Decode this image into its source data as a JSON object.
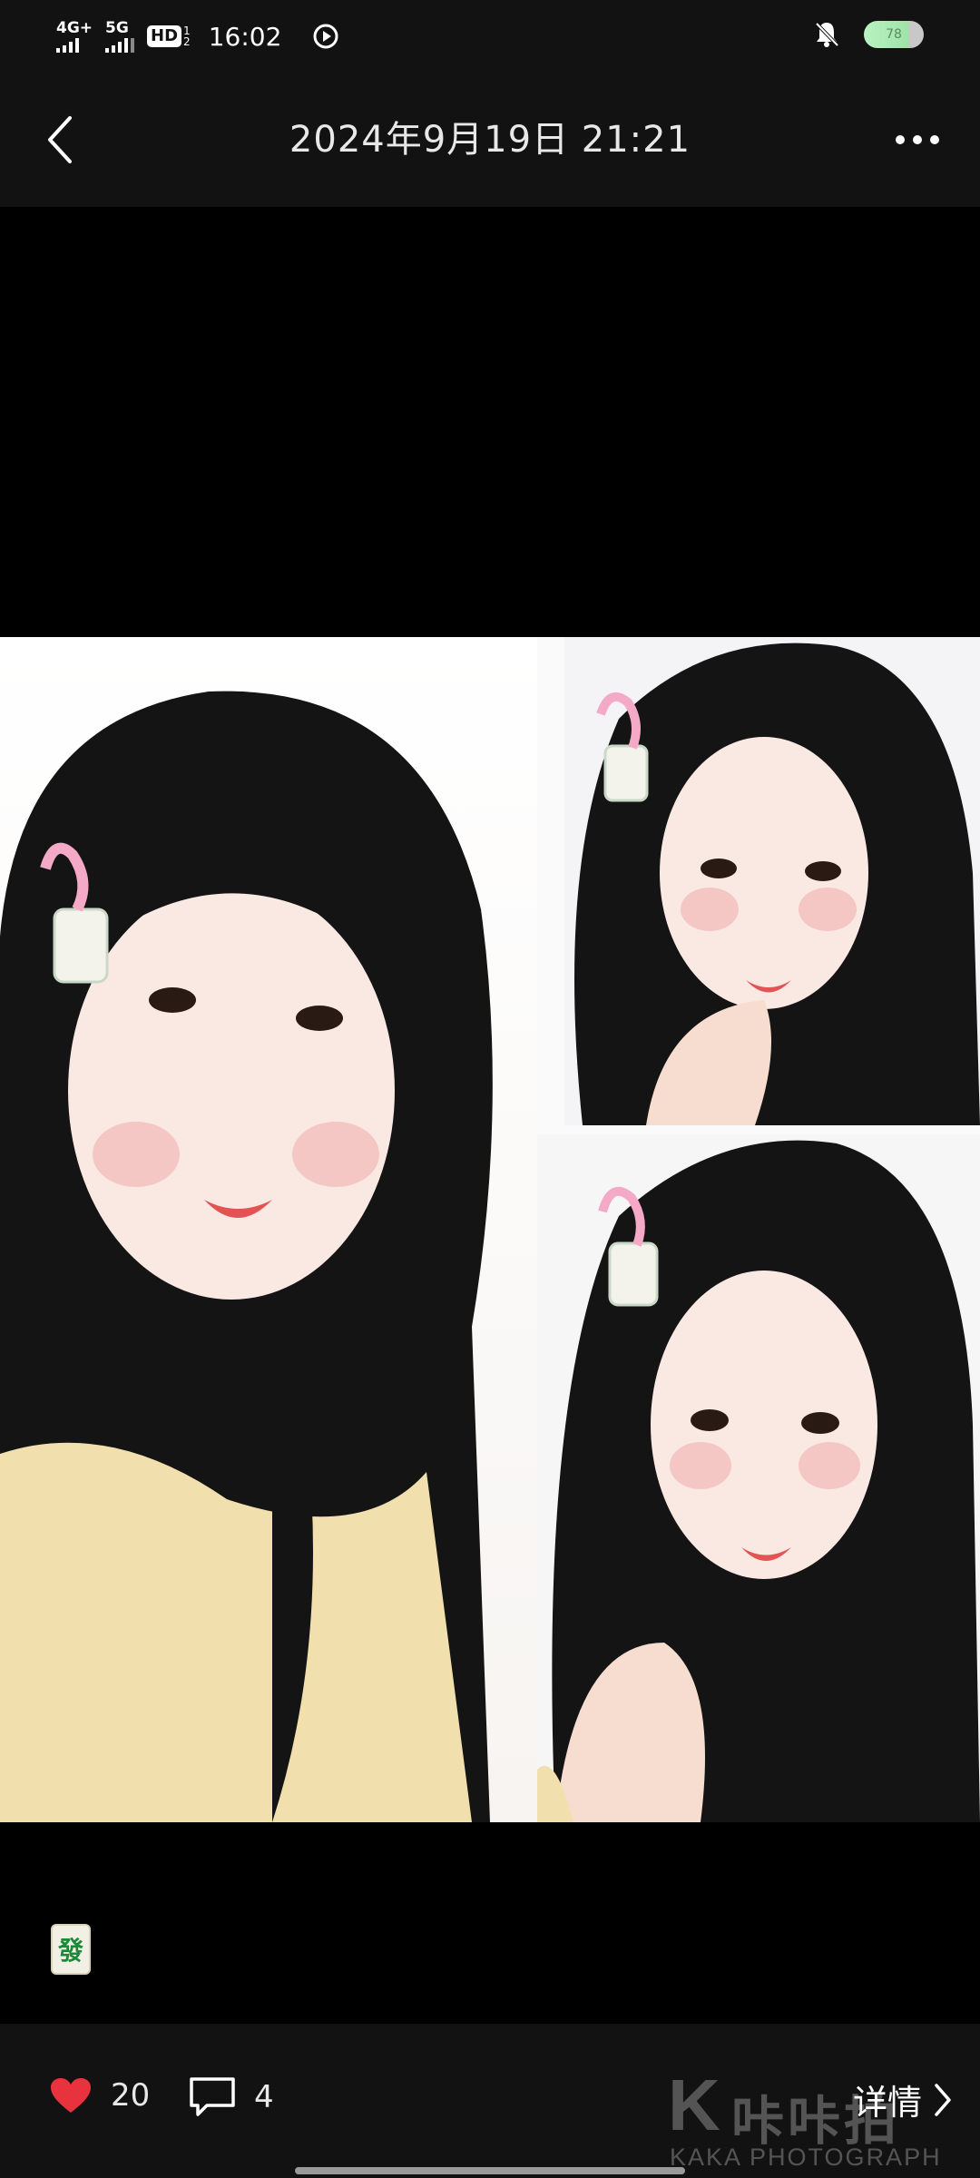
{
  "status_bar": {
    "network_1": "4G+",
    "network_2": "5G",
    "hd_label": "HD",
    "hd_sub_1": "1",
    "hd_sub_2": "2",
    "time": "16:02",
    "battery": "78"
  },
  "header": {
    "title": "2024年9月19日 21:21"
  },
  "content": {
    "tile_glyph": "發"
  },
  "footer": {
    "like_count": "20",
    "comment_count": "4",
    "detail_label": "详情",
    "watermark_letter": "K",
    "watermark_cn": "咔咔拍",
    "watermark_en": "KAKA PHOTOGRAPH"
  },
  "colors": {
    "like_heart": "#e8333f",
    "bar_background": "#121212",
    "photo_background": "#000000"
  }
}
